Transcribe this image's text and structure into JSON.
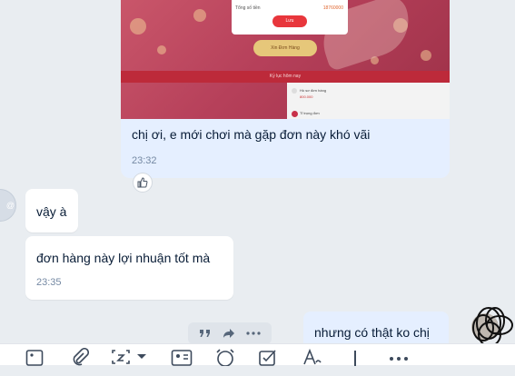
{
  "messages": {
    "outgoing_image": {
      "screenshot": {
        "panel_label": "Tổng số tiền",
        "panel_amount": "18760000",
        "confirm_label": "Lưu",
        "gold_button": "Xin Đơn Hàng",
        "strip_label": "Kỷ lục hôm nay",
        "list_row1": "Hồ sơ đơn hàng",
        "list_row1_value": "800.000",
        "list_row2": "Tỉ trọng đơn"
      },
      "text": "chị ơi, e mới chơi mà gặp đơn này khó vãi",
      "time": "23:32"
    },
    "incoming_1": {
      "text": "vậy à"
    },
    "incoming_2": {
      "text": "đơn hàng này lợi nhuận tốt mà",
      "time": "23:35"
    },
    "outgoing_2": {
      "text": "nhưng có thật ko chị"
    }
  },
  "colors": {
    "chat_bg": "#e9edf1",
    "outgoing_bubble": "#e5efff",
    "incoming_bubble": "#ffffff",
    "time_text": "#7589a3",
    "body_text": "#081c36"
  },
  "icons": {
    "reaction": "thumbs-up-icon",
    "message_actions": [
      "quote-icon",
      "forward-icon",
      "more-icon"
    ],
    "toolbar": [
      "image-icon",
      "attach-icon",
      "screenshot-icon",
      "chevron-down-icon",
      "contact-card-icon",
      "reminder-icon",
      "task-icon",
      "text-format-icon",
      "cursor-icon",
      "more-icon"
    ]
  }
}
